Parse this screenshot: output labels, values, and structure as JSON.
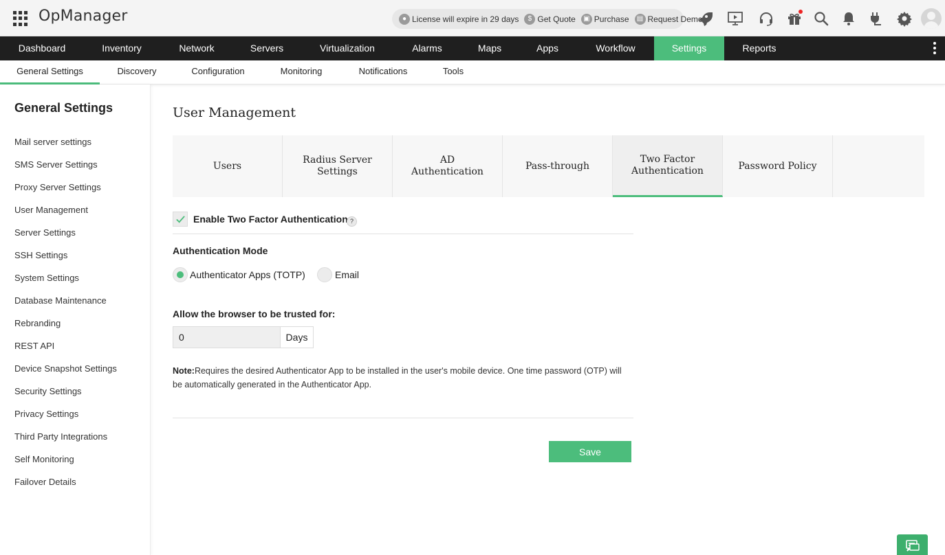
{
  "app": {
    "title": "OpManager"
  },
  "topbar": {
    "license_text": "License will expire in 29 days",
    "get_quote": "Get Quote",
    "purchase": "Purchase",
    "request_demo": "Request Demo",
    "icons": [
      "rocket-icon",
      "presentation-icon",
      "headset-icon",
      "gift-icon",
      "search-icon",
      "bell-icon",
      "plug-icon",
      "gear-icon",
      "user-avatar-icon"
    ]
  },
  "main_nav": {
    "items": [
      "Dashboard",
      "Inventory",
      "Network",
      "Servers",
      "Virtualization",
      "Alarms",
      "Maps",
      "Apps",
      "Workflow",
      "Settings",
      "Reports"
    ],
    "active": "Settings"
  },
  "sub_nav": {
    "items": [
      "General Settings",
      "Discovery",
      "Configuration",
      "Monitoring",
      "Notifications",
      "Tools"
    ],
    "active": "General Settings"
  },
  "sidebar": {
    "title": "General Settings",
    "items": [
      "Mail server settings",
      "SMS Server Settings",
      "Proxy Server Settings",
      "User Management",
      "Server Settings",
      "SSH Settings",
      "System Settings",
      "Database Maintenance",
      "Rebranding",
      "REST API",
      "Device Snapshot Settings",
      "Security Settings",
      "Privacy Settings",
      "Third Party Integrations",
      "Self Monitoring",
      "Failover Details"
    ]
  },
  "content": {
    "title": "User Management",
    "tabs": {
      "users": "Users",
      "radius_1": "Radius Server",
      "radius_2": "Settings",
      "ad_1": "AD",
      "ad_2": "Authentication",
      "passthrough": "Pass-through",
      "twofa_1": "Two Factor",
      "twofa_2": "Authentication",
      "password_policy": "Password Policy",
      "active": "Two Factor Authentication"
    },
    "enable_2fa": {
      "label": "Enable Two Factor Authentication",
      "checked": true,
      "help": "?"
    },
    "auth_mode": {
      "label": "Authentication Mode",
      "options": [
        "Authenticator Apps (TOTP)",
        "Email"
      ],
      "selected": "Authenticator Apps (TOTP)"
    },
    "trust": {
      "label": "Allow the browser to be trusted for:",
      "value": "0",
      "unit": "Days"
    },
    "note": {
      "prefix": "Note:",
      "line1": "Requires the desired Authenticator App to be installed in the user's mobile device. One time password (OTP) will",
      "line2": "be automatically generated in the Authenticator App."
    },
    "save_label": "Save"
  },
  "colors": {
    "accent": "#4cbd7c",
    "nav_bg": "#1f1f1f",
    "topbar_bg": "#f4f4f4"
  }
}
